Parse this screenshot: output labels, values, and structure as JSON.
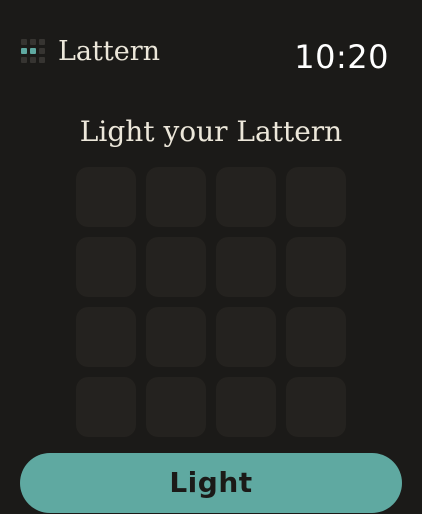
{
  "app": {
    "name": "Lattern",
    "icon": "lattern-grid-icon"
  },
  "status_bar": {
    "time": "10:20"
  },
  "main": {
    "headline": "Light your Lattern",
    "grid": {
      "rows": 4,
      "columns": 4,
      "lit_cells": 0
    }
  },
  "action": {
    "button_label": "Light"
  },
  "colors": {
    "background": "#1b1a18",
    "accent": "#5fa9a1",
    "cell_off": "#24221f",
    "text": "#ece7da"
  }
}
